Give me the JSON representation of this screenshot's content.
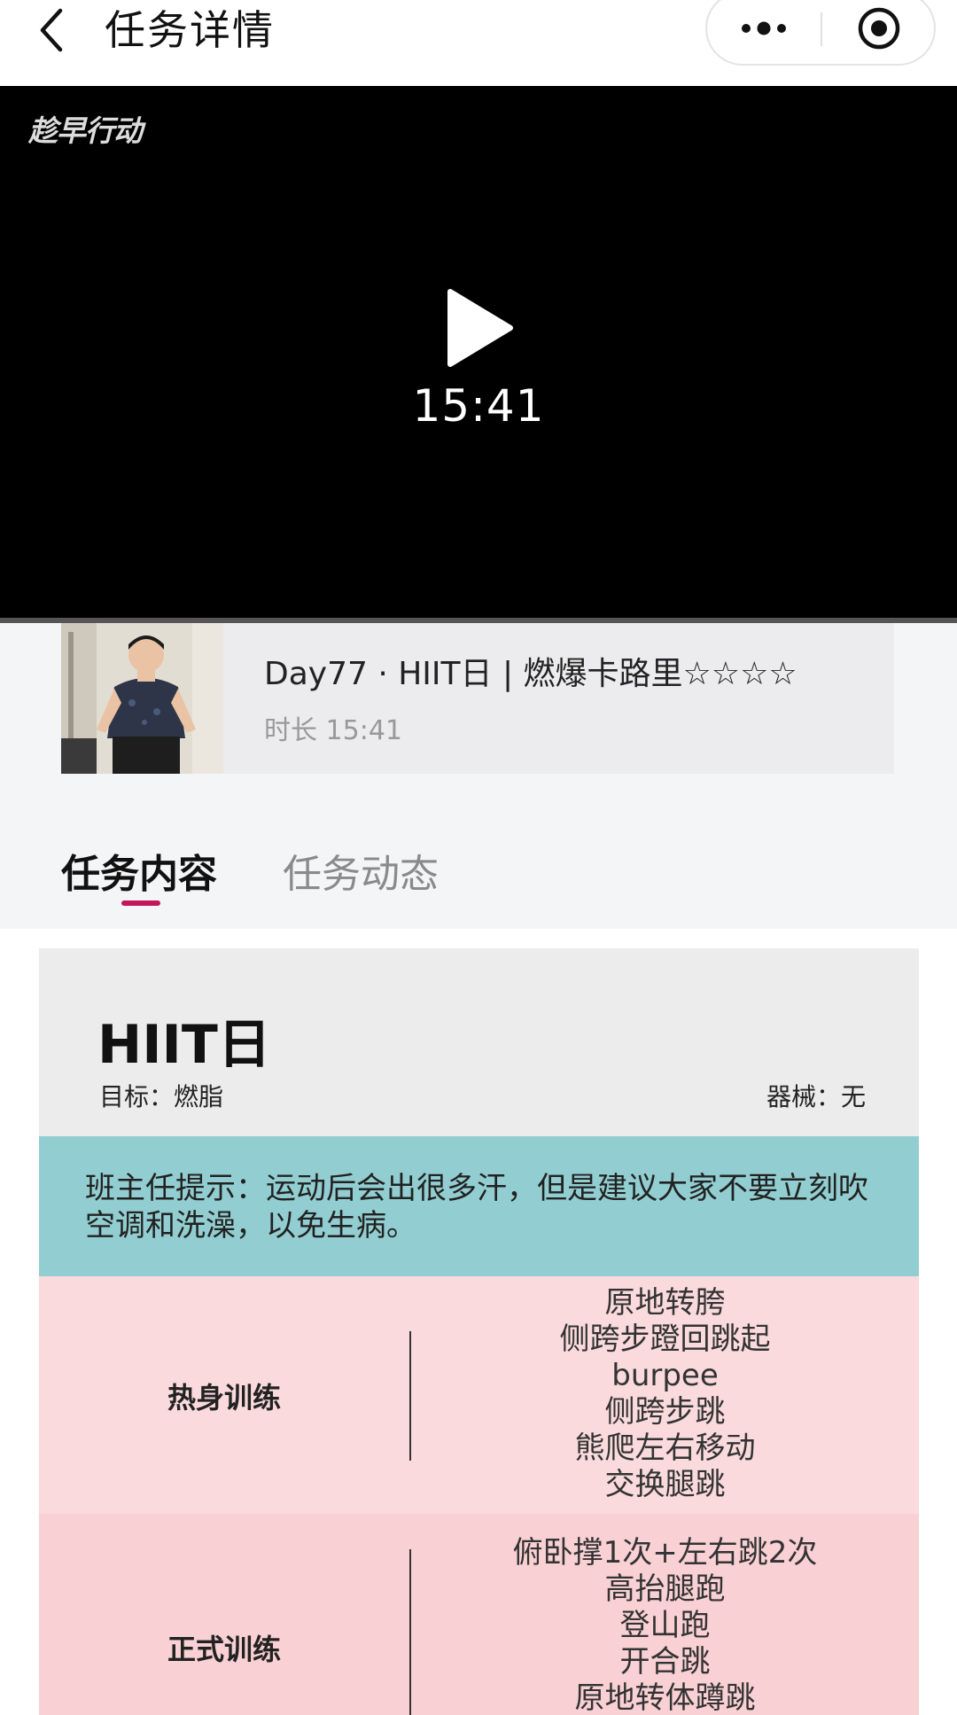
{
  "navbar": {
    "title": "任务详情"
  },
  "video": {
    "logo_text": "趁早行动",
    "duration": "15:41"
  },
  "course": {
    "title": "Day77 · HIIT日 | 燃爆卡路里☆☆☆☆",
    "meta": "时长 15:41"
  },
  "tabs": [
    {
      "label": "任务内容",
      "active": true
    },
    {
      "label": "任务动态",
      "active": false
    }
  ],
  "plan": {
    "title": "HIIT日",
    "goal": "目标：燃脂",
    "equipment": "器械：无",
    "tip": "班主任提示：运动后会出很多汗，但是建议大家不要立刻吹空调和洗澡，以免生病。",
    "sections": [
      {
        "label": "热身训练",
        "exercises": [
          "原地转胯",
          "侧跨步蹬回跳起",
          "burpee",
          "侧跨步跳",
          "熊爬左右移动",
          "交换腿跳"
        ]
      },
      {
        "label": "正式训练",
        "exercises": [
          "俯卧撑1次+左右跳2次",
          "高抬腿跑",
          "登山跑",
          "开合跳",
          "原地转体蹲跳"
        ]
      }
    ]
  },
  "colors": {
    "accent": "#c2185b",
    "tip_background": "#92ced1",
    "warmup_background": "#fadadd",
    "main_background": "#f9d0d4"
  }
}
